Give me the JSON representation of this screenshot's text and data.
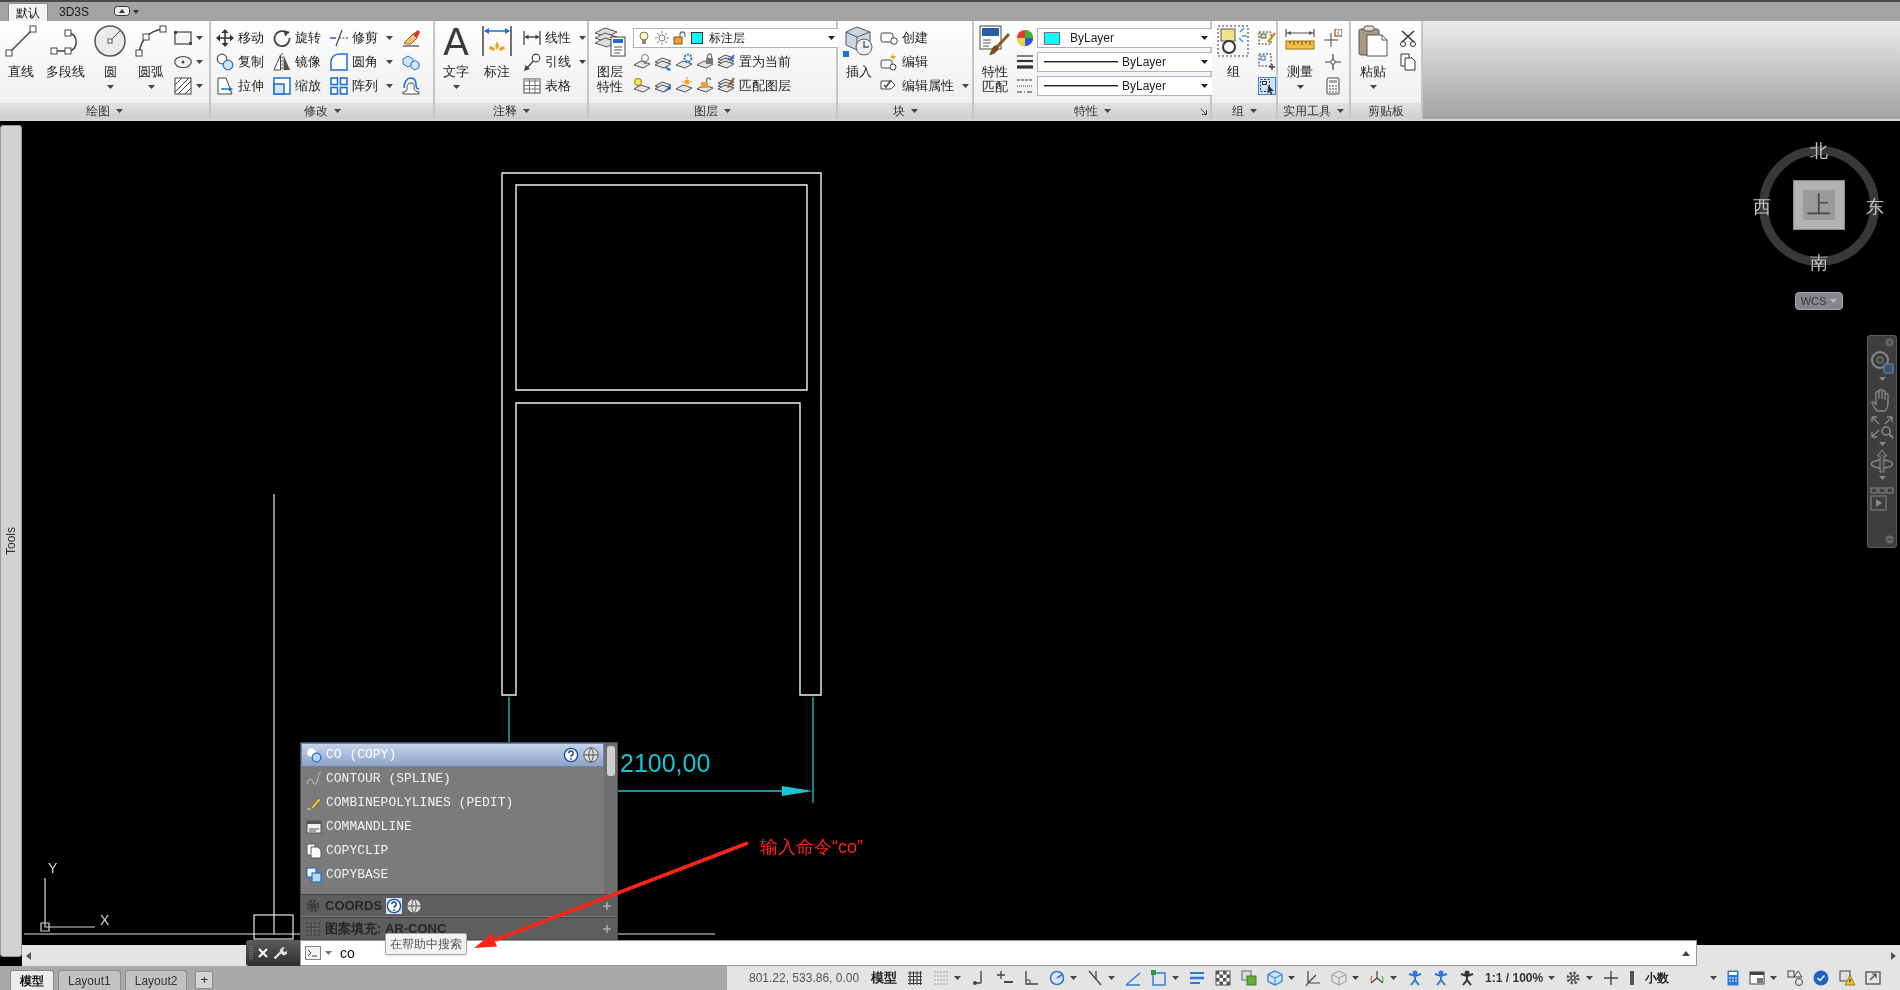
{
  "tabs": [
    {
      "label": "默认",
      "selected": true
    },
    {
      "label": "3D3S",
      "selected": false
    }
  ],
  "panels": [
    {
      "title": "绘图",
      "menu": true,
      "launcher": false,
      "columns": [
        [
          {
            "kind": "large",
            "label": "直线",
            "menu": false
          }
        ],
        [
          {
            "kind": "large",
            "label": "多段线",
            "menu": false
          }
        ],
        [
          {
            "kind": "large",
            "label": "圆",
            "menu": true
          }
        ],
        [
          {
            "kind": "large",
            "label": "圆弧",
            "menu": true
          }
        ],
        [
          {
            "kind": "icon",
            "menu": true
          },
          {
            "kind": "icon",
            "menu": true
          },
          {
            "kind": "icon",
            "menu": true
          }
        ]
      ]
    },
    {
      "title": "修改",
      "menu": true,
      "launcher": false,
      "columns": [
        [
          {
            "kind": "small",
            "label": "移动",
            "menu": false
          },
          {
            "kind": "small",
            "label": "复制",
            "menu": false
          },
          {
            "kind": "small",
            "label": "拉伸",
            "menu": false
          }
        ],
        [
          {
            "kind": "small",
            "label": "旋转",
            "menu": false
          },
          {
            "kind": "small",
            "label": "镜像",
            "menu": false
          },
          {
            "kind": "small",
            "label": "缩放",
            "menu": false
          }
        ],
        [
          {
            "kind": "small",
            "label": "修剪",
            "menu": true
          },
          {
            "kind": "small",
            "label": "圆角",
            "menu": true
          },
          {
            "kind": "small",
            "label": "阵列",
            "menu": true
          }
        ],
        [
          {
            "kind": "icon",
            "menu": false
          },
          {
            "kind": "icon",
            "menu": false
          },
          {
            "kind": "icon",
            "menu": false
          }
        ]
      ]
    },
    {
      "title": "注释",
      "menu": true,
      "launcher": false,
      "columns": [
        [
          {
            "kind": "large",
            "label": "文字",
            "glyph": "A",
            "menu": true
          }
        ],
        [
          {
            "kind": "large",
            "label": "标注",
            "menu": false
          }
        ],
        [
          {
            "kind": "small",
            "label": "线性",
            "menu": true
          },
          {
            "kind": "small",
            "label": "引线",
            "menu": true
          },
          {
            "kind": "small",
            "label": "表格",
            "menu": false
          }
        ]
      ]
    },
    {
      "title": "图层",
      "menu": true,
      "launcher": false,
      "columns": [
        [
          {
            "kind": "large",
            "label": "图层特性",
            "menu": false
          }
        ],
        [
          {
            "kind": "layer_combo",
            "value": "标注层",
            "color": "#00ffff"
          },
          {
            "kind": "row",
            "items": [
              {
                "kind": "icon",
                "menu": false
              },
              {
                "kind": "icon",
                "menu": false
              },
              {
                "kind": "icon",
                "menu": false
              },
              {
                "kind": "icon",
                "menu": false
              },
              {
                "kind": "small",
                "label": "置为当前",
                "menu": false
              }
            ]
          },
          {
            "kind": "row",
            "items": [
              {
                "kind": "icon",
                "menu": false
              },
              {
                "kind": "icon",
                "menu": false
              },
              {
                "kind": "icon",
                "menu": false
              },
              {
                "kind": "icon",
                "menu": false
              },
              {
                "kind": "small",
                "label": "匹配图层",
                "menu": false
              }
            ]
          }
        ]
      ]
    },
    {
      "title": "块",
      "menu": true,
      "launcher": false,
      "columns": [
        [
          {
            "kind": "large",
            "label": "插入",
            "menu": false
          }
        ],
        [
          {
            "kind": "small",
            "label": "创建",
            "menu": false
          },
          {
            "kind": "small",
            "label": "编辑",
            "menu": false
          },
          {
            "kind": "small",
            "label": "编辑属性",
            "menu": true
          }
        ]
      ]
    },
    {
      "title": "特性",
      "menu": true,
      "launcher": true,
      "columns": [
        [
          {
            "kind": "large",
            "label": "特性匹配",
            "menu": false
          }
        ],
        [
          {
            "kind": "icon",
            "menu": false
          },
          {
            "kind": "icon",
            "menu": false
          },
          {
            "kind": "icon",
            "menu": false
          }
        ],
        [
          {
            "kind": "color_combo",
            "value": "ByLayer",
            "color": "#00ffff"
          },
          {
            "kind": "line_combo",
            "value": "ByLayer"
          },
          {
            "kind": "line_combo",
            "value": "ByLayer"
          }
        ]
      ]
    },
    {
      "title": "组",
      "menu": true,
      "launcher": false,
      "columns": [
        [
          {
            "kind": "large",
            "label": "组",
            "menu": false
          }
        ],
        [
          {
            "kind": "icon",
            "menu": false,
            "on": false
          },
          {
            "kind": "icon",
            "menu": false,
            "on": false
          },
          {
            "kind": "icon",
            "menu": false,
            "on": true
          }
        ]
      ]
    },
    {
      "title": "实用工具",
      "menu": true,
      "launcher": false,
      "columns": [
        [
          {
            "kind": "large",
            "label": "测量",
            "menu": true
          }
        ],
        [
          {
            "kind": "icon",
            "menu": false
          },
          {
            "kind": "icon",
            "menu": false
          },
          {
            "kind": "icon",
            "menu": false
          }
        ]
      ]
    },
    {
      "title": "剪贴板",
      "menu": false,
      "launcher": false,
      "columns": [
        [
          {
            "kind": "large",
            "label": "粘贴",
            "menu": true
          }
        ],
        [
          {
            "kind": "icon",
            "menu": false
          },
          {
            "kind": "icon",
            "menu": false
          }
        ]
      ]
    }
  ],
  "tool_palette": {
    "title": "Tools"
  },
  "drawing": {
    "dimension_text": "2100,00",
    "ucs_x": "X",
    "ucs_y": "Y"
  },
  "view_cube": {
    "top_face": "上",
    "north": "北",
    "south": "南",
    "west": "西",
    "east": "东",
    "ucs_menu": "WCS"
  },
  "autocomplete": {
    "items": [
      {
        "label": "CO (COPY)",
        "selected": true
      },
      {
        "label": "CONTOUR (SPLINE)",
        "selected": false
      },
      {
        "label": "COMBINEPOLYLINES (PEDIT)",
        "selected": false
      },
      {
        "label": "COMMANDLINE",
        "selected": false
      },
      {
        "label": "COPYCLIP",
        "selected": false
      },
      {
        "label": "COPYBASE",
        "selected": false
      }
    ],
    "groups": [
      {
        "label": "COORDS",
        "active": true
      },
      {
        "label": "图案填充: AR-CONC",
        "active": false
      }
    ]
  },
  "annotation": {
    "text": "输入命令“co”"
  },
  "command_line": {
    "value": "co",
    "tooltip": "在帮助中搜索"
  },
  "layout_tabs": {
    "tabs": [
      {
        "label": "模型",
        "selected": true
      },
      {
        "label": "Layout1",
        "selected": false
      },
      {
        "label": "Layout2",
        "selected": false
      }
    ],
    "add": "+"
  },
  "status_bar": {
    "coordinates": "801.22, 533.86, 0.00",
    "space": "模型",
    "annotation_scale": "1:1 / 100%",
    "units": "小数"
  }
}
